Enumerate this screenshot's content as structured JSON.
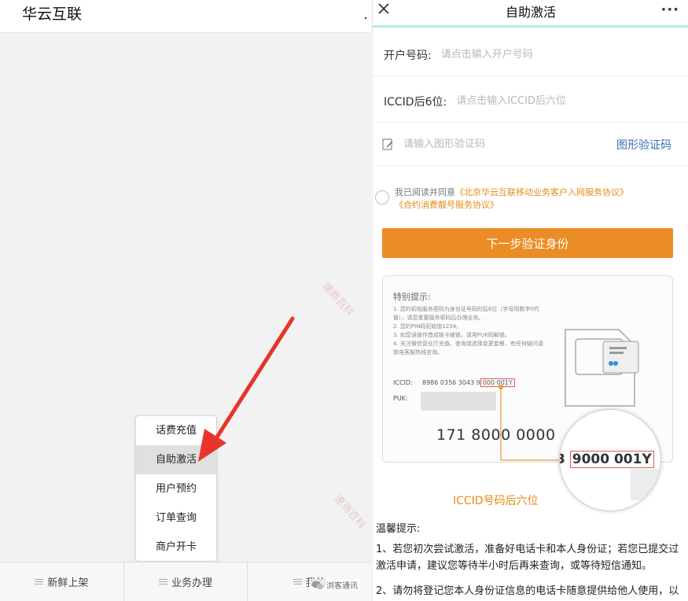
{
  "left": {
    "title": "华云互联",
    "header_dot": ".",
    "popup_menu": [
      {
        "label": "话费充值"
      },
      {
        "label": "自助激活"
      },
      {
        "label": "用户预约"
      },
      {
        "label": "订单查询"
      },
      {
        "label": "商户开卡"
      }
    ],
    "bottom_nav": [
      {
        "label": "新鲜上架"
      },
      {
        "label": "业务办理"
      },
      {
        "label": "我的"
      }
    ]
  },
  "right": {
    "title": "自助激活",
    "more": "···",
    "account": {
      "label": "开户号码:",
      "placeholder": "请点击输入开户号码"
    },
    "iccid": {
      "label": "ICCID后6位:",
      "placeholder": "请点击输入ICCID后六位"
    },
    "captcha": {
      "placeholder": "请输入图形验证码",
      "button": "图形验证码"
    },
    "agreement": {
      "prefix": "我已阅读并同意",
      "link1": "《北京华云互联移动业务客户入网服务协议》",
      "link2": "《合约消费靓号服务协议》"
    },
    "next_button": "下一步验证身份",
    "card": {
      "title": "特别提示:",
      "notes": [
        "1. 您的初始服务密码为身份证号码的后6位（字母用数字0代替），请您重置服务密码后办理业务。",
        "2. 您的PIN码初始值1234。",
        "3. 如您误操作造成锁卡被锁，请用PUK码解锁。",
        "4. 关注微信营业厅充值、查询或选择变更套餐，有任何疑问请致电客服热线咨询。"
      ],
      "iccid_label": "ICCID:",
      "iccid_prefix": "8986 0356 3043 9",
      "iccid_highlight": "000 001Y",
      "puk_label": "PUK:",
      "big_number": "171 8000 0000",
      "magnified_prefix": "3 ",
      "magnified_highlight": "9000 001Y"
    },
    "iccid_caption": "ICCID号码后六位",
    "tips_title": "温馨提示:",
    "tips": [
      "1、若您初次尝试激活，准备好电话卡和本人身份证；若您已提交过激活申请，建议您等待半小时后再来查询，或等待短信通知。",
      "2、请勿将登记您本人身份证信息的电话卡随意提供给他人使用，以"
    ]
  },
  "watermark": "速商百科",
  "badge": "浏客通讯",
  "colors": {
    "orange": "#eb8d24",
    "link_blue": "#3a6fb4",
    "header_accent": "#b6ecd7",
    "arrow_red": "#e8342a"
  }
}
